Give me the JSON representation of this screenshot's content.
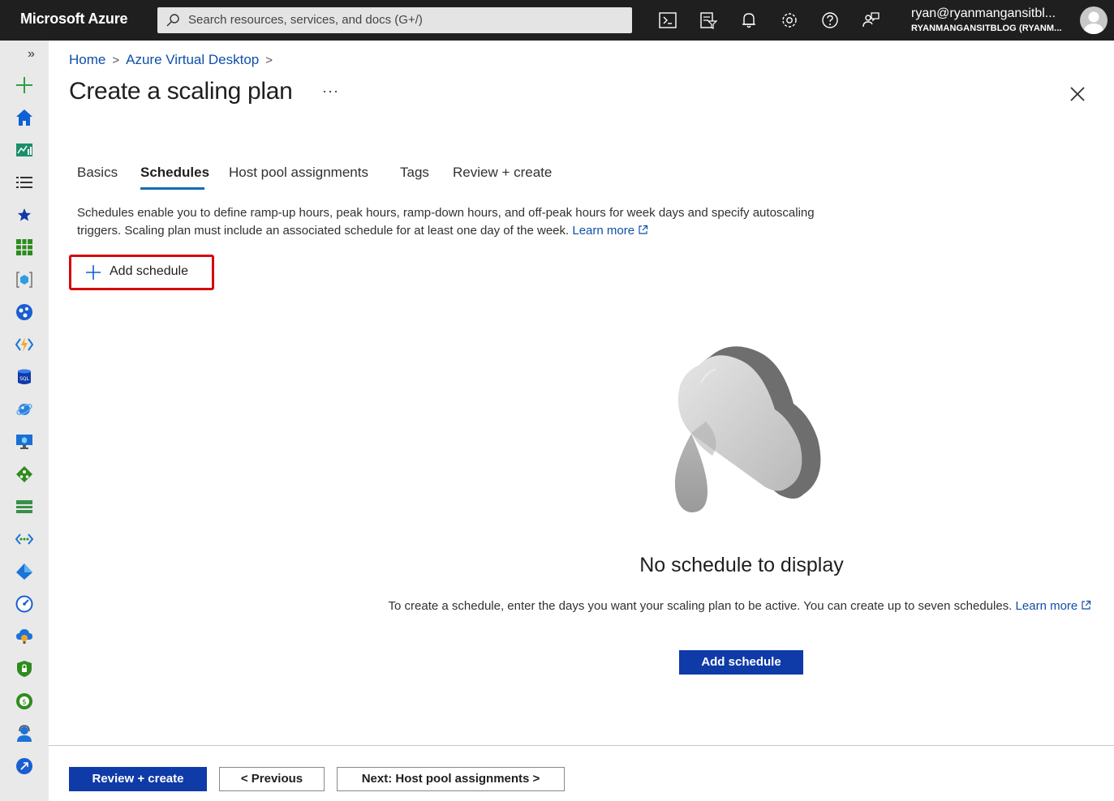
{
  "topbar": {
    "brand": "Microsoft Azure",
    "search_placeholder": "Search resources, services, and docs (G+/)",
    "icons": [
      "cloud-shell-icon",
      "directory-filter-icon",
      "notifications-icon",
      "settings-icon",
      "help-icon",
      "feedback-icon"
    ],
    "account_name": "ryan@ryanmangansitbl...",
    "account_directory": "RYANMANGANSITBLOG (RYANM..."
  },
  "rail": {
    "expand_glyph": "»",
    "items": [
      "create-resource-icon",
      "home-icon",
      "dashboard-icon",
      "all-services-icon",
      "favorites-icon",
      "all-resources-icon",
      "resource-groups-icon",
      "app-services-icon",
      "function-app-icon",
      "sql-database-icon",
      "cosmos-db-icon",
      "virtual-machines-icon",
      "load-balancers-icon",
      "storage-accounts-icon",
      "virtual-networks-icon",
      "azure-ad-icon",
      "monitor-icon",
      "advisor-icon",
      "defender-icon",
      "cost-management-icon",
      "help-support-icon",
      "azure-virtual-desktop-icon"
    ]
  },
  "breadcrumb": {
    "home": "Home",
    "parent": "Azure Virtual Desktop",
    "sep": ">"
  },
  "page": {
    "title": "Create a scaling plan",
    "more": "···"
  },
  "tabs": [
    {
      "label": "Basics"
    },
    {
      "label": "Schedules"
    },
    {
      "label": "Host pool assignments"
    },
    {
      "label": "Tags"
    },
    {
      "label": "Review + create"
    }
  ],
  "active_tab": "Schedules",
  "description": {
    "text": "Schedules enable you to define ramp-up hours, peak hours, ramp-down hours, and off-peak hours for week days and specify autoscaling triggers. Scaling plan must include an associated schedule for at least one day of the week.",
    "link": "Learn more"
  },
  "command": {
    "add_schedule": "Add schedule"
  },
  "empty_state": {
    "title": "No schedule to display",
    "text": "To create a schedule, enter the days you want your scaling plan to be active. You can create up to seven schedules.",
    "link": "Learn more",
    "button": "Add schedule"
  },
  "footer": {
    "review": "Review + create",
    "previous": "< Previous",
    "next": "Next: Host pool assignments >"
  },
  "colors": {
    "accent": "#0f3ba8",
    "link": "#0f4fa8",
    "highlight": "#d6060e",
    "topbar": "#1f1f1f"
  }
}
